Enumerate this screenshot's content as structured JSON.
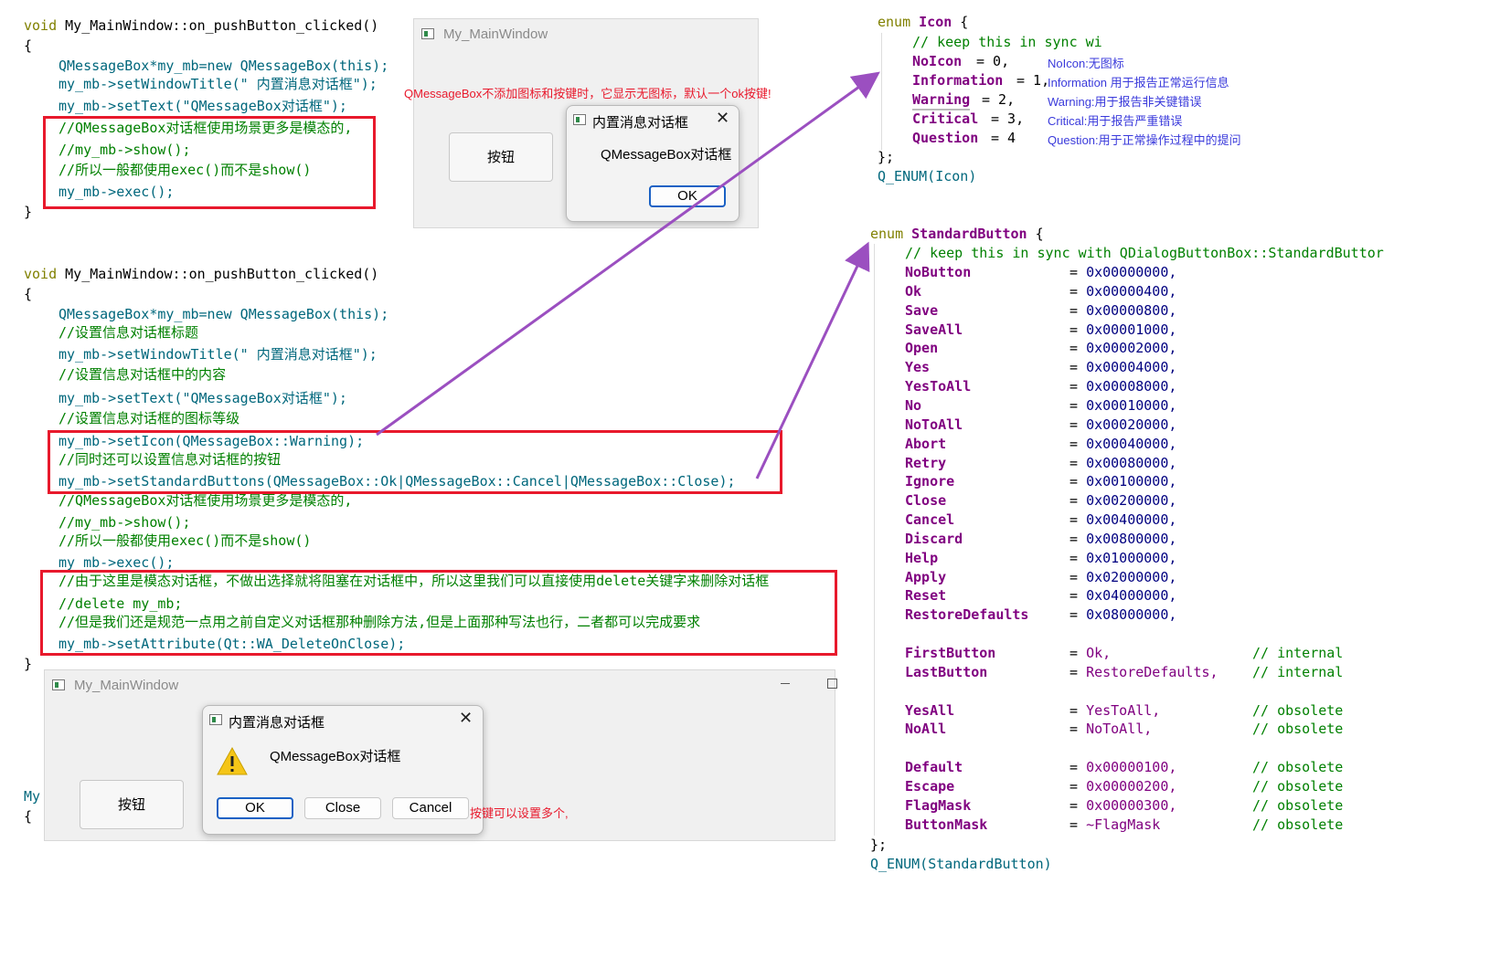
{
  "top_code": {
    "signature": "My_MainWindow::on_pushButton_clicked()",
    "lines": [
      "QMessageBox*my_mb=new QMessageBox(this);",
      "my_mb->setWindowTitle(\" 内置消息对话框\");",
      "my_mb->setText(\"QMessageBox对话框\");",
      "//QMessageBox对话框使用场景更多是模态的,",
      "//my_mb->show();",
      "//所以一般都使用exec()而不是show()",
      "my_mb->exec();"
    ]
  },
  "top_window": {
    "title": "My_MainWindow",
    "button_label": "按钮",
    "annotation": "QMessageBox不添加图标和按键时，它显示无图标，默认一个ok按键!",
    "dialog": {
      "title": "内置消息对话框",
      "text": "QMessageBox对话框",
      "ok_label": "OK"
    }
  },
  "bottom_code": {
    "signature": "My_MainWindow::on_pushButton_clicked()",
    "lines": [
      "QMessageBox*my_mb=new QMessageBox(this);",
      "//设置信息对话框标题",
      "my_mb->setWindowTitle(\" 内置消息对话框\");",
      "//设置信息对话框中的内容",
      "my_mb->setText(\"QMessageBox对话框\");",
      "//设置信息对话框的图标等级",
      "my_mb->setIcon(QMessageBox::Warning);",
      "//同时还可以设置信息对话框的按钮",
      "my_mb->setStandardButtons(QMessageBox::Ok|QMessageBox::Cancel|QMessageBox::Close);",
      "//QMessageBox对话框使用场景更多是模态的,",
      "//my_mb->show();",
      "//所以一般都使用exec()而不是show()",
      "my_mb->exec();",
      "//由于这里是模态对话框，不做出选择就将阻塞在对话框中，所以这里我们可以直接使用delete关键字来删除对话框",
      "//delete my_mb;",
      "//但是我们还是规范一点用之前自定义对话框那种删除方法,但是上面那种写法也行，二者都可以完成要求",
      "my_mb->setAttribute(Qt::WA_DeleteOnClose);"
    ],
    "trailing_fragment": "My"
  },
  "bottom_window": {
    "title": "My_MainWindow",
    "button_label": "按钮",
    "annotation": "按键可以设置多个,",
    "dialog": {
      "title": "内置消息对话框",
      "text": "QMessageBox对话框",
      "buttons": [
        "OK",
        "Close",
        "Cancel"
      ],
      "icon": "warning-icon"
    }
  },
  "icon_enum": {
    "header": "enum Icon {",
    "comment": "// keep this in sync wi",
    "entries": [
      {
        "name": "NoIcon",
        "value": "= 0,",
        "note": "NoIcon:无图标"
      },
      {
        "name": "Information",
        "value": "= 1,",
        "note": "Information 用于报告正常运行信息"
      },
      {
        "name": "Warning",
        "value": "= 2,",
        "note": "Warning:用于报告非关键错误"
      },
      {
        "name": "Critical",
        "value": "= 3,",
        "note": "Critical:用于报告严重错误"
      },
      {
        "name": "Question",
        "value": "= 4",
        "note": "Question:用于正常操作过程中的提问"
      }
    ],
    "close": "};",
    "macro": "Q_ENUM(Icon)"
  },
  "button_enum": {
    "header": "enum StandardButton {",
    "comment": "// keep this in sync with QDialogButtonBox::StandardButtor",
    "entries": [
      {
        "name": "NoButton",
        "value": "0x00000000,"
      },
      {
        "name": "Ok",
        "value": "0x00000400,"
      },
      {
        "name": "Save",
        "value": "0x00000800,"
      },
      {
        "name": "SaveAll",
        "value": "0x00001000,"
      },
      {
        "name": "Open",
        "value": "0x00002000,"
      },
      {
        "name": "Yes",
        "value": "0x00004000,"
      },
      {
        "name": "YesToAll",
        "value": "0x00008000,"
      },
      {
        "name": "No",
        "value": "0x00010000,"
      },
      {
        "name": "NoToAll",
        "value": "0x00020000,"
      },
      {
        "name": "Abort",
        "value": "0x00040000,"
      },
      {
        "name": "Retry",
        "value": "0x00080000,"
      },
      {
        "name": "Ignore",
        "value": "0x00100000,"
      },
      {
        "name": "Close",
        "value": "0x00200000,"
      },
      {
        "name": "Cancel",
        "value": "0x00400000,"
      },
      {
        "name": "Discard",
        "value": "0x00800000,"
      },
      {
        "name": "Help",
        "value": "0x01000000,"
      },
      {
        "name": "Apply",
        "value": "0x02000000,"
      },
      {
        "name": "Reset",
        "value": "0x04000000,"
      },
      {
        "name": "RestoreDefaults",
        "value": "0x08000000,"
      }
    ],
    "extra_groups": [
      [
        {
          "name": "FirstButton",
          "value": "Ok,",
          "comment": "// internal"
        },
        {
          "name": "LastButton",
          "value": "RestoreDefaults,",
          "comment": "// internal"
        }
      ],
      [
        {
          "name": "YesAll",
          "value": "YesToAll,",
          "comment": "// obsolete"
        },
        {
          "name": "NoAll",
          "value": "NoToAll,",
          "comment": "// obsolete"
        }
      ],
      [
        {
          "name": "Default",
          "value": "0x00000100,",
          "comment": "// obsolete"
        },
        {
          "name": "Escape",
          "value": "0x00000200,",
          "comment": "// obsolete"
        },
        {
          "name": "FlagMask",
          "value": "0x00000300,",
          "comment": "// obsolete"
        },
        {
          "name": "ButtonMask",
          "value": "~FlagMask",
          "comment": "// obsolete"
        }
      ]
    ],
    "close": "};",
    "macro": "Q_ENUM(StandardButton)"
  },
  "colors": {
    "highlight_box": "#e8192c",
    "arrow": "#9b4fc0",
    "note_blue": "#3a3adb"
  }
}
